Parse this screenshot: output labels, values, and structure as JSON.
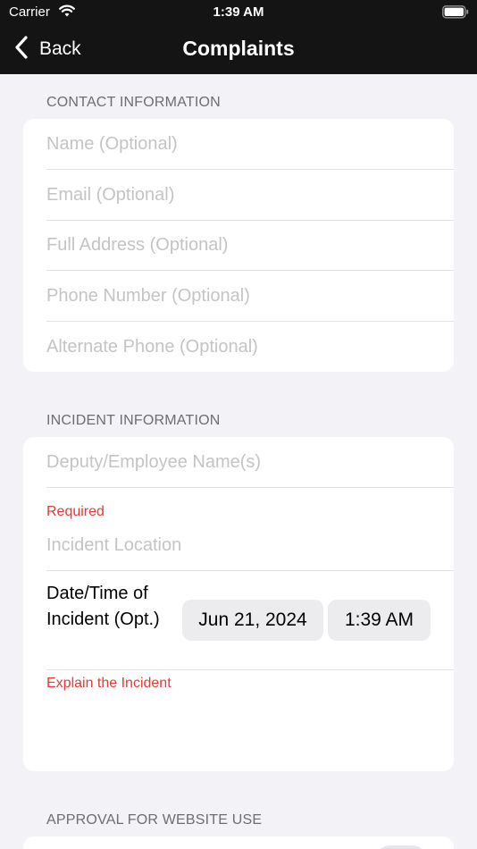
{
  "status_bar": {
    "carrier": "Carrier",
    "time": "1:39 AM"
  },
  "nav": {
    "back_label": "Back",
    "title": "Complaints"
  },
  "contact": {
    "header": "CONTACT INFORMATION",
    "fields": [
      {
        "placeholder": "Name (Optional)",
        "value": ""
      },
      {
        "placeholder": "Email (Optional)",
        "value": ""
      },
      {
        "placeholder": "Full Address (Optional)",
        "value": ""
      },
      {
        "placeholder": "Phone Number (Optional)",
        "value": ""
      },
      {
        "placeholder": "Alternate Phone (Optional)",
        "value": ""
      }
    ]
  },
  "incident": {
    "header": "INCIDENT INFORMATION",
    "employee_placeholder": "Deputy/Employee Name(s)",
    "location_required": "Required",
    "location_placeholder": "Incident Location",
    "datetime_label": "Date/Time of Incident (Opt.)",
    "date_value": "Jun 21, 2024",
    "time_value": "1:39 AM",
    "explain_required": "Explain the Incident"
  },
  "approval": {
    "header": "APPROVAL FOR WEBSITE USE"
  },
  "colors": {
    "nav_bg": "#141414",
    "page_bg": "#f2f2f7",
    "required": "#e53935",
    "placeholder": "#c4c4c6"
  }
}
